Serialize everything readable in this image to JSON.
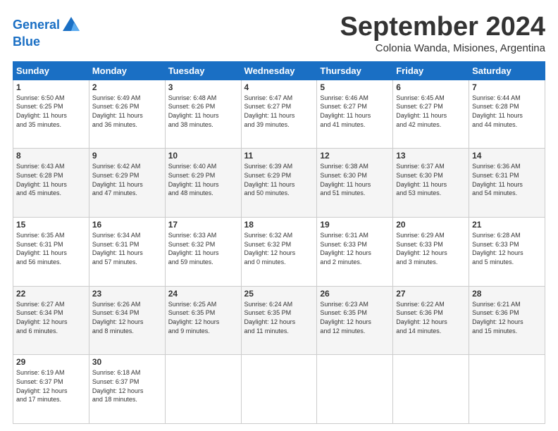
{
  "header": {
    "logo_line1": "General",
    "logo_line2": "Blue",
    "month_title": "September 2024",
    "subtitle": "Colonia Wanda, Misiones, Argentina"
  },
  "days_of_week": [
    "Sunday",
    "Monday",
    "Tuesday",
    "Wednesday",
    "Thursday",
    "Friday",
    "Saturday"
  ],
  "weeks": [
    [
      {
        "day": "1",
        "lines": [
          "Sunrise: 6:50 AM",
          "Sunset: 6:25 PM",
          "Daylight: 11 hours",
          "and 35 minutes."
        ]
      },
      {
        "day": "2",
        "lines": [
          "Sunrise: 6:49 AM",
          "Sunset: 6:26 PM",
          "Daylight: 11 hours",
          "and 36 minutes."
        ]
      },
      {
        "day": "3",
        "lines": [
          "Sunrise: 6:48 AM",
          "Sunset: 6:26 PM",
          "Daylight: 11 hours",
          "and 38 minutes."
        ]
      },
      {
        "day": "4",
        "lines": [
          "Sunrise: 6:47 AM",
          "Sunset: 6:27 PM",
          "Daylight: 11 hours",
          "and 39 minutes."
        ]
      },
      {
        "day": "5",
        "lines": [
          "Sunrise: 6:46 AM",
          "Sunset: 6:27 PM",
          "Daylight: 11 hours",
          "and 41 minutes."
        ]
      },
      {
        "day": "6",
        "lines": [
          "Sunrise: 6:45 AM",
          "Sunset: 6:27 PM",
          "Daylight: 11 hours",
          "and 42 minutes."
        ]
      },
      {
        "day": "7",
        "lines": [
          "Sunrise: 6:44 AM",
          "Sunset: 6:28 PM",
          "Daylight: 11 hours",
          "and 44 minutes."
        ]
      }
    ],
    [
      {
        "day": "8",
        "lines": [
          "Sunrise: 6:43 AM",
          "Sunset: 6:28 PM",
          "Daylight: 11 hours",
          "and 45 minutes."
        ]
      },
      {
        "day": "9",
        "lines": [
          "Sunrise: 6:42 AM",
          "Sunset: 6:29 PM",
          "Daylight: 11 hours",
          "and 47 minutes."
        ]
      },
      {
        "day": "10",
        "lines": [
          "Sunrise: 6:40 AM",
          "Sunset: 6:29 PM",
          "Daylight: 11 hours",
          "and 48 minutes."
        ]
      },
      {
        "day": "11",
        "lines": [
          "Sunrise: 6:39 AM",
          "Sunset: 6:29 PM",
          "Daylight: 11 hours",
          "and 50 minutes."
        ]
      },
      {
        "day": "12",
        "lines": [
          "Sunrise: 6:38 AM",
          "Sunset: 6:30 PM",
          "Daylight: 11 hours",
          "and 51 minutes."
        ]
      },
      {
        "day": "13",
        "lines": [
          "Sunrise: 6:37 AM",
          "Sunset: 6:30 PM",
          "Daylight: 11 hours",
          "and 53 minutes."
        ]
      },
      {
        "day": "14",
        "lines": [
          "Sunrise: 6:36 AM",
          "Sunset: 6:31 PM",
          "Daylight: 11 hours",
          "and 54 minutes."
        ]
      }
    ],
    [
      {
        "day": "15",
        "lines": [
          "Sunrise: 6:35 AM",
          "Sunset: 6:31 PM",
          "Daylight: 11 hours",
          "and 56 minutes."
        ]
      },
      {
        "day": "16",
        "lines": [
          "Sunrise: 6:34 AM",
          "Sunset: 6:31 PM",
          "Daylight: 11 hours",
          "and 57 minutes."
        ]
      },
      {
        "day": "17",
        "lines": [
          "Sunrise: 6:33 AM",
          "Sunset: 6:32 PM",
          "Daylight: 11 hours",
          "and 59 minutes."
        ]
      },
      {
        "day": "18",
        "lines": [
          "Sunrise: 6:32 AM",
          "Sunset: 6:32 PM",
          "Daylight: 12 hours",
          "and 0 minutes."
        ]
      },
      {
        "day": "19",
        "lines": [
          "Sunrise: 6:31 AM",
          "Sunset: 6:33 PM",
          "Daylight: 12 hours",
          "and 2 minutes."
        ]
      },
      {
        "day": "20",
        "lines": [
          "Sunrise: 6:29 AM",
          "Sunset: 6:33 PM",
          "Daylight: 12 hours",
          "and 3 minutes."
        ]
      },
      {
        "day": "21",
        "lines": [
          "Sunrise: 6:28 AM",
          "Sunset: 6:33 PM",
          "Daylight: 12 hours",
          "and 5 minutes."
        ]
      }
    ],
    [
      {
        "day": "22",
        "lines": [
          "Sunrise: 6:27 AM",
          "Sunset: 6:34 PM",
          "Daylight: 12 hours",
          "and 6 minutes."
        ]
      },
      {
        "day": "23",
        "lines": [
          "Sunrise: 6:26 AM",
          "Sunset: 6:34 PM",
          "Daylight: 12 hours",
          "and 8 minutes."
        ]
      },
      {
        "day": "24",
        "lines": [
          "Sunrise: 6:25 AM",
          "Sunset: 6:35 PM",
          "Daylight: 12 hours",
          "and 9 minutes."
        ]
      },
      {
        "day": "25",
        "lines": [
          "Sunrise: 6:24 AM",
          "Sunset: 6:35 PM",
          "Daylight: 12 hours",
          "and 11 minutes."
        ]
      },
      {
        "day": "26",
        "lines": [
          "Sunrise: 6:23 AM",
          "Sunset: 6:35 PM",
          "Daylight: 12 hours",
          "and 12 minutes."
        ]
      },
      {
        "day": "27",
        "lines": [
          "Sunrise: 6:22 AM",
          "Sunset: 6:36 PM",
          "Daylight: 12 hours",
          "and 14 minutes."
        ]
      },
      {
        "day": "28",
        "lines": [
          "Sunrise: 6:21 AM",
          "Sunset: 6:36 PM",
          "Daylight: 12 hours",
          "and 15 minutes."
        ]
      }
    ],
    [
      {
        "day": "29",
        "lines": [
          "Sunrise: 6:19 AM",
          "Sunset: 6:37 PM",
          "Daylight: 12 hours",
          "and 17 minutes."
        ]
      },
      {
        "day": "30",
        "lines": [
          "Sunrise: 6:18 AM",
          "Sunset: 6:37 PM",
          "Daylight: 12 hours",
          "and 18 minutes."
        ]
      },
      null,
      null,
      null,
      null,
      null
    ]
  ]
}
